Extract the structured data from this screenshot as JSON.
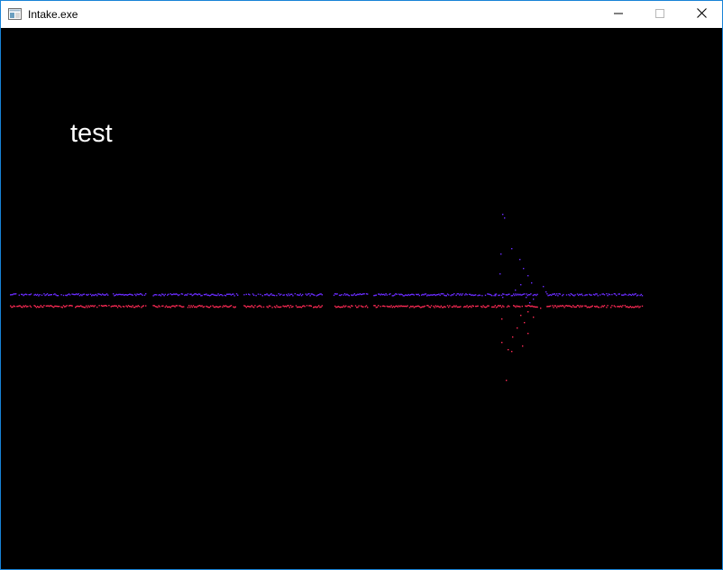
{
  "window": {
    "title": "Intake.exe",
    "app_icon": "application-window-icon",
    "buttons": {
      "minimize_icon": "minimize-icon",
      "maximize_icon": "maximize-icon",
      "close_icon": "close-icon"
    }
  },
  "canvas": {
    "background": "#000000",
    "overlay_text": "test",
    "overlay_text_color": "#ffffff",
    "signal_colors": {
      "upper": "#6a2cff",
      "lower": "#ff2a55"
    }
  }
}
